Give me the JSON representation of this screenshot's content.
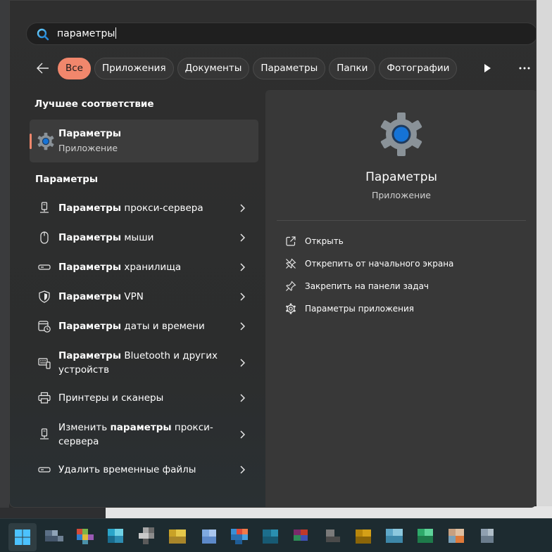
{
  "search": {
    "value": "параметры"
  },
  "chips": [
    {
      "label": "Все",
      "active": true
    },
    {
      "label": "Приложения",
      "active": false
    },
    {
      "label": "Документы",
      "active": false
    },
    {
      "label": "Параметры",
      "active": false
    },
    {
      "label": "Папки",
      "active": false
    },
    {
      "label": "Фотографии",
      "active": false
    }
  ],
  "best_match": {
    "heading": "Лучшее соответствие",
    "title": "Параметры",
    "subtitle": "Приложение"
  },
  "settings_section": {
    "heading": "Параметры",
    "items": [
      {
        "bold": "Параметры",
        "rest": " прокси-сервера",
        "icon": "proxy-icon"
      },
      {
        "bold": "Параметры",
        "rest": " мыши",
        "icon": "mouse-icon"
      },
      {
        "bold": "Параметры",
        "rest": " хранилища",
        "icon": "storage-icon"
      },
      {
        "bold": "Параметры",
        "rest": " VPN",
        "icon": "shield-icon"
      },
      {
        "bold": "Параметры",
        "rest": " даты и времени",
        "icon": "calendar-clock-icon"
      },
      {
        "bold": "Параметры",
        "rest": " Bluetooth и других устройств",
        "icon": "devices-icon"
      },
      {
        "bold": "",
        "rest": "Принтеры и сканеры",
        "icon": "printer-icon"
      },
      {
        "pre": "Изменить ",
        "bold": "параметры",
        "rest": " прокси-сервера",
        "icon": "proxy-icon"
      },
      {
        "bold": "",
        "rest": "Удалить временные файлы",
        "icon": "storage-icon"
      }
    ]
  },
  "preview": {
    "title": "Параметры",
    "subtitle": "Приложение",
    "actions": [
      {
        "label": "Открыть",
        "icon": "open-external-icon"
      },
      {
        "label": "Открепить от начального экрана",
        "icon": "unpin-icon"
      },
      {
        "label": "Закрепить на панели задач",
        "icon": "pin-icon"
      },
      {
        "label": "Параметры приложения",
        "icon": "gear-icon"
      }
    ]
  },
  "colors": {
    "accent": "#f1876c",
    "panel": "#2c2c2c",
    "preview_panel": "#383838",
    "selected_item": "#3c3c3c",
    "taskbar": "#1d2b30"
  }
}
